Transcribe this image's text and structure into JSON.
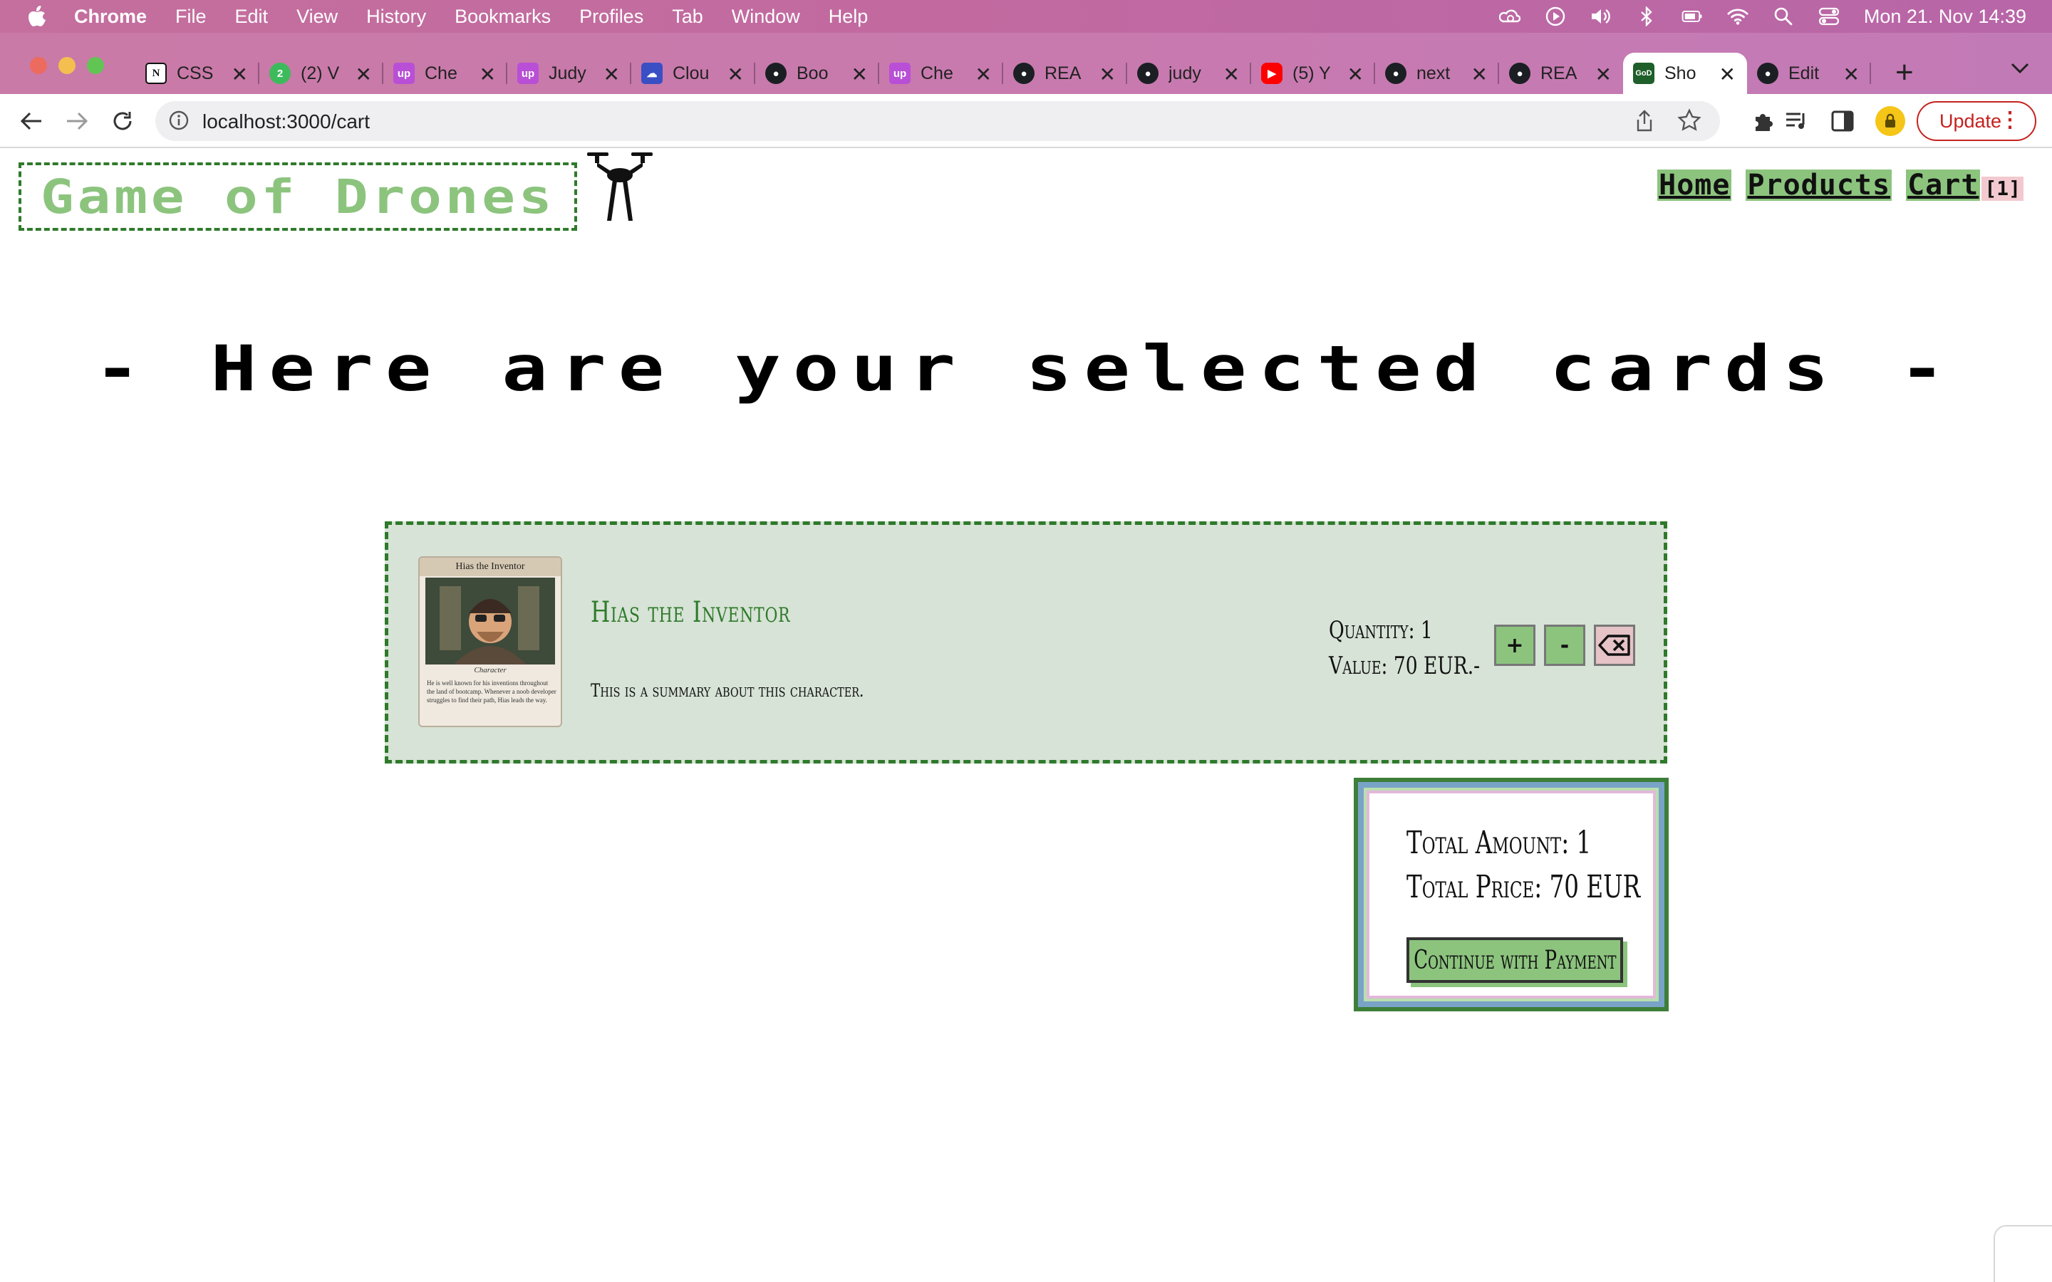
{
  "menubar": {
    "app": "Chrome",
    "items": [
      "File",
      "Edit",
      "View",
      "History",
      "Bookmarks",
      "Profiles",
      "Tab",
      "Window",
      "Help"
    ],
    "clock": "Mon 21. Nov  14:39"
  },
  "tabs": [
    {
      "title": "CSS",
      "icon": "notion-icon",
      "active": false
    },
    {
      "title": "(2) V",
      "icon": "badge-icon",
      "active": false
    },
    {
      "title": "Che",
      "icon": "upwork-icon",
      "active": false
    },
    {
      "title": "Judy",
      "icon": "upwork-icon",
      "active": false
    },
    {
      "title": "Clou",
      "icon": "cloud-icon",
      "active": false
    },
    {
      "title": "Boo",
      "icon": "github-icon",
      "active": false
    },
    {
      "title": "Che",
      "icon": "upwork-icon",
      "active": false
    },
    {
      "title": "REA",
      "icon": "github-icon",
      "active": false
    },
    {
      "title": "judy",
      "icon": "github-icon",
      "active": false
    },
    {
      "title": "(5) Y",
      "icon": "youtube-icon",
      "active": false
    },
    {
      "title": "next",
      "icon": "github-icon",
      "active": false
    },
    {
      "title": "REA",
      "icon": "github-icon",
      "active": false
    },
    {
      "title": "Sho",
      "icon": "god-favicon",
      "favicon_text": "GoD",
      "active": true
    },
    {
      "title": "Edit",
      "icon": "github-icon",
      "active": false
    }
  ],
  "toolbar": {
    "url": "localhost:3000/cart",
    "update_label": "Update"
  },
  "site": {
    "logo": "Game of Drones",
    "nav": {
      "home": "Home",
      "products": "Products",
      "cart": "Cart",
      "cart_count": "[1]"
    }
  },
  "page": {
    "heading": "- Here are your selected cards -"
  },
  "cart": {
    "items": [
      {
        "name": "Hias the Inventor",
        "summary": "This is a summary about this character.",
        "quantity": "Quantity: 1",
        "value": "Value: 70 EUR.-",
        "thumb_title": "Hias the Inventor",
        "thumb_type": "Character",
        "thumb_text": "He is well known for his inventions throughout the land of bootcamp. Whenever a noob developer struggles to find their path, Hias leads the way."
      }
    ],
    "buttons": {
      "plus": "+",
      "minus": "-"
    }
  },
  "summary": {
    "amount": "Total Amount: 1",
    "price": "Total Price: 70 EUR",
    "pay": "Continue with Payment"
  },
  "colors": {
    "accent_green": "#8cc47e",
    "border_green": "#2f7a2b",
    "card_bg": "#d7e3d6",
    "delete_bg": "#e6c3c6"
  }
}
